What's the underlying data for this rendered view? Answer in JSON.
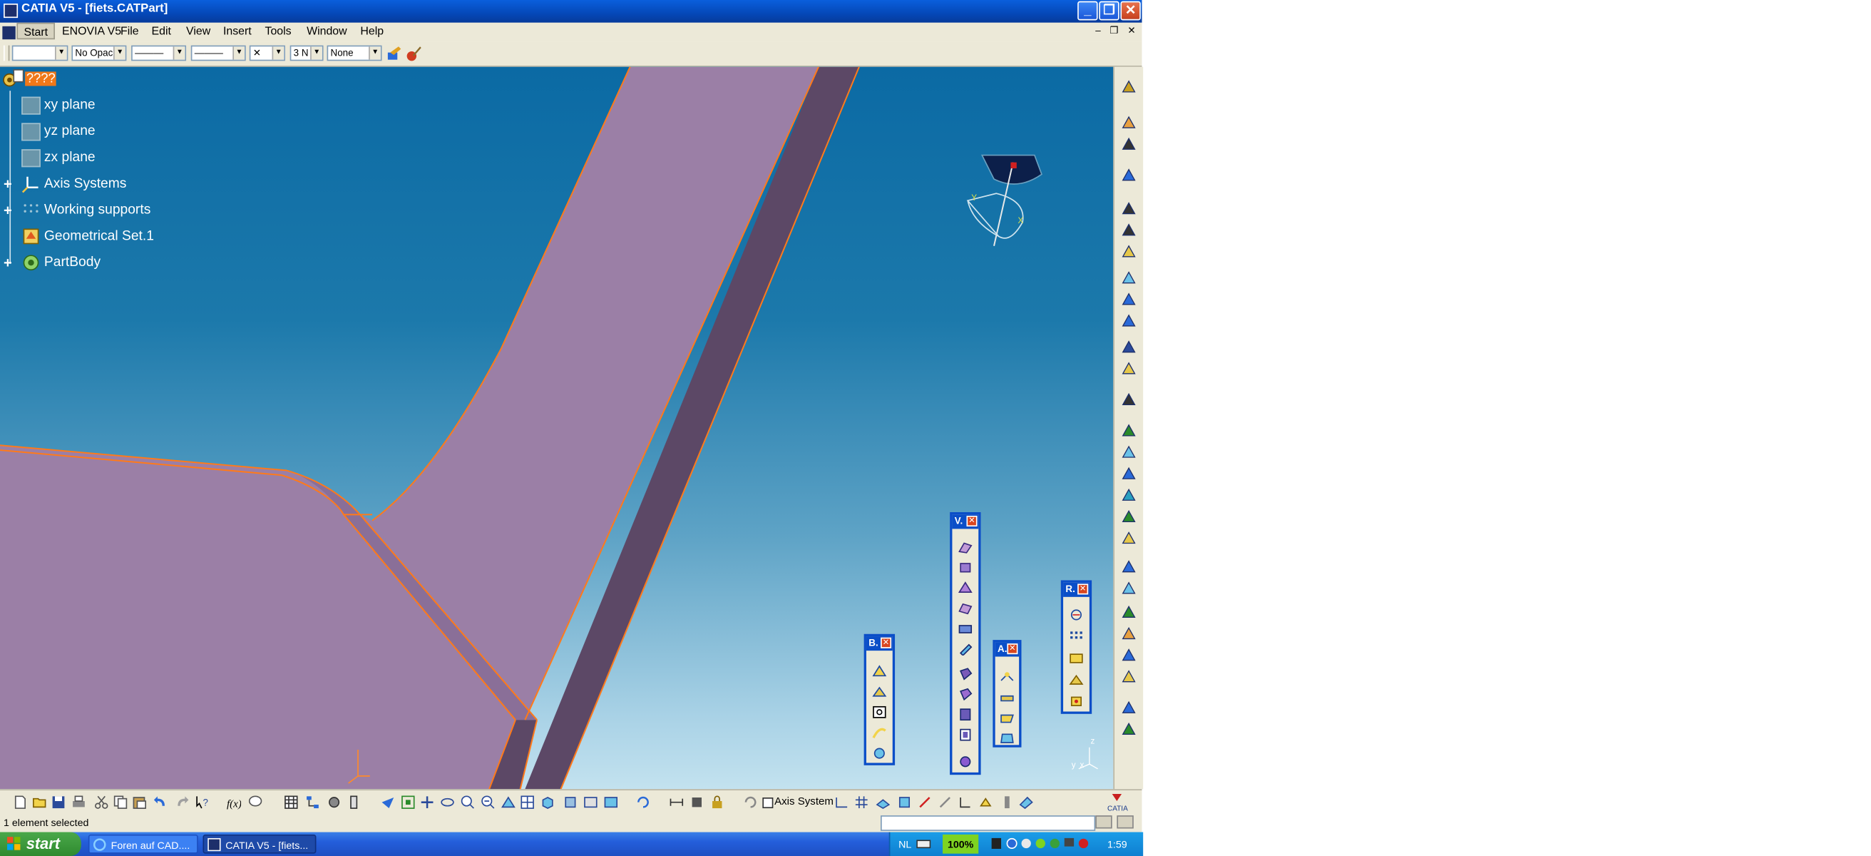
{
  "window": {
    "title": "CATIA V5 - [fiets.CATPart]",
    "minimize_glyph": "_",
    "maximize_glyph": "❐",
    "close_glyph": "✕"
  },
  "menu": {
    "items": [
      "Start",
      "ENOVIA V5",
      "File",
      "Edit",
      "View",
      "Insert",
      "Tools",
      "Window",
      "Help"
    ],
    "doc_min": "–",
    "doc_restore": "❐",
    "doc_close": "✕"
  },
  "graphic_properties": {
    "color_value": "",
    "opacity_value": "No Opac",
    "linetype_value": "———",
    "thickness_value": "———",
    "point_value": "✕",
    "layer_value": "3 N",
    "filter_value": "None"
  },
  "tree": {
    "root_label": "????",
    "items": [
      "xy plane",
      "yz plane",
      "zx plane",
      "Axis Systems",
      "Working supports",
      "Geometrical Set.1",
      "PartBody"
    ]
  },
  "compass": {
    "label_y": "Y",
    "label_x": "X"
  },
  "axis_triad": {
    "z": "z",
    "y": "y",
    "x": "x"
  },
  "palettes": {
    "b_title": "B.",
    "v_title": "V.",
    "a_title": "A.",
    "r_title": "R.",
    "close_glyph": "✕"
  },
  "bottom_toolbar": {
    "axis_system_label": "Axis System"
  },
  "status": {
    "message": "1 element selected"
  },
  "taskbar": {
    "start_label": "start",
    "tasks": [
      "Foren auf CAD....",
      "CATIA V5 - [fiets..."
    ],
    "language": "NL",
    "zoom_badge": "100%",
    "clock": "1:59"
  },
  "colors": {
    "part_face": "#9b7fa6",
    "part_side": "#5c4866",
    "edge_highlight": "#ff7a1a",
    "title_bar": "#0a5fdc",
    "taskbar": "#245edb",
    "start_button": "#3a963a"
  }
}
